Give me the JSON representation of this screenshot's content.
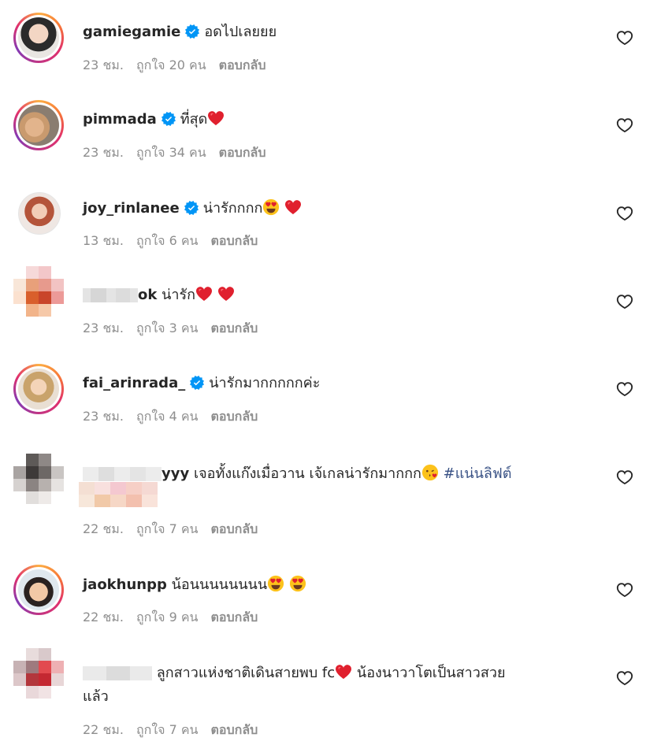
{
  "comments": [
    {
      "user": "gamiegamie",
      "text": "อดไปเลยยย",
      "time": "23 ชม.",
      "likes": "ถูกใจ 20 คน",
      "reply": "ตอบกลับ"
    },
    {
      "user": "pimmada",
      "text": "ที่สุด",
      "time": "23 ชม.",
      "likes": "ถูกใจ 34 คน",
      "reply": "ตอบกลับ"
    },
    {
      "user": "joy_rinlanee",
      "text": "น่ารักกกก",
      "time": "13 ชม.",
      "likes": "ถูกใจ 6 คน",
      "reply": "ตอบกลับ"
    },
    {
      "user": "ok",
      "text": "น่ารัก",
      "time": "23 ชม.",
      "likes": "ถูกใจ 3 คน",
      "reply": "ตอบกลับ"
    },
    {
      "user": "fai_arinrada_",
      "text": "น่ารักมากกกกกค่ะ",
      "time": "23 ชม.",
      "likes": "ถูกใจ 4 คน",
      "reply": "ตอบกลับ"
    },
    {
      "user": "yyy",
      "text": "เจอทั้งแก๊งเมื่อวาน เจ้เกลน่ารักมากกก",
      "hashtag": "#แน่นลิฟต์",
      "time": "22 ชม.",
      "likes": "ถูกใจ 7 คน",
      "reply": "ตอบกลับ"
    },
    {
      "user": "jaokhunpp",
      "text": "น้อนนนนนนนน",
      "time": "22 ชม.",
      "likes": "ถูกใจ 9 คน",
      "reply": "ตอบกลับ"
    },
    {
      "user": "j",
      "text": "ลูกสาวแห่งชาติเดินสายพบ fc",
      "text2": "น้องนาวาโตเป็นสาวสวย",
      "text3": "แล้ว",
      "time": "22 ชม.",
      "likes": "ถูกใจ 7 คน",
      "reply": "ตอบกลับ"
    }
  ],
  "icons": {
    "verified": "verified-badge-icon",
    "like": "heart-outline-icon",
    "emoji_heart": "red-heart-emoji",
    "emoji_love": "heart-eyes-emoji",
    "emoji_kiss": "kiss-emoji"
  },
  "colors": {
    "verified": "#0095f6",
    "link": "#385185",
    "muted": "#8e8e8e",
    "heart": "#ed4956"
  }
}
